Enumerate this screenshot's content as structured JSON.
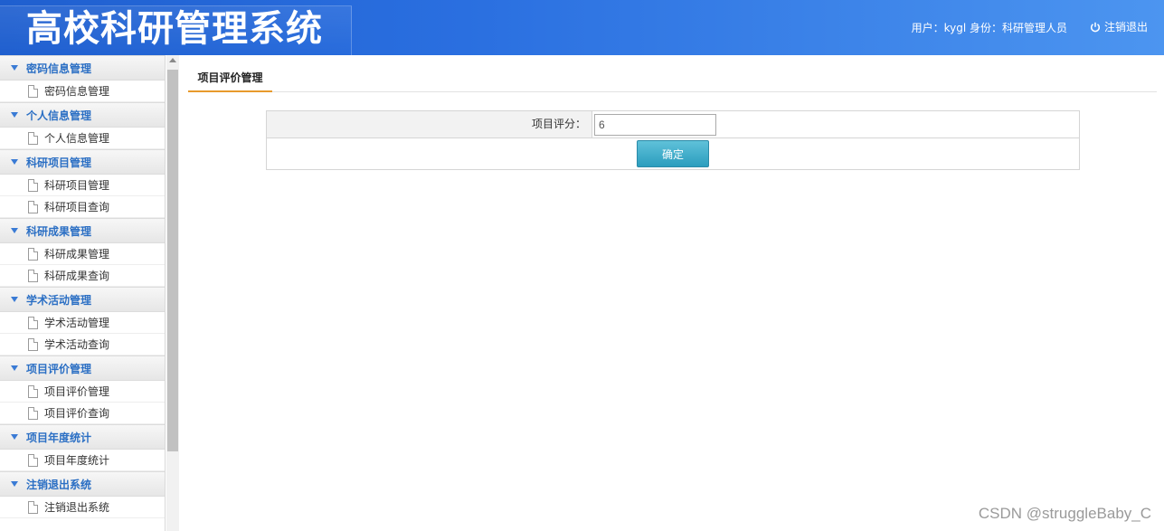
{
  "header": {
    "app_title": "高校科研管理系统",
    "user_info": "用户：kygl 身份：科研管理人员",
    "logout_label": "注销退出"
  },
  "sidebar": {
    "groups": [
      {
        "title": "密码信息管理",
        "items": [
          "密码信息管理"
        ]
      },
      {
        "title": "个人信息管理",
        "items": [
          "个人信息管理"
        ]
      },
      {
        "title": "科研项目管理",
        "items": [
          "科研项目管理",
          "科研项目查询"
        ]
      },
      {
        "title": "科研成果管理",
        "items": [
          "科研成果管理",
          "科研成果查询"
        ]
      },
      {
        "title": "学术活动管理",
        "items": [
          "学术活动管理",
          "学术活动查询"
        ]
      },
      {
        "title": "项目评价管理",
        "items": [
          "项目评价管理",
          "项目评价查询"
        ]
      },
      {
        "title": "项目年度统计",
        "items": [
          "项目年度统计"
        ]
      },
      {
        "title": "注销退出系统",
        "items": [
          "注销退出系统"
        ]
      }
    ]
  },
  "main": {
    "tab_label": "项目评价管理",
    "form": {
      "score_label": "项目评分：",
      "score_value": "6",
      "submit_label": "确定"
    }
  },
  "watermark": "CSDN @struggleBaby_C"
}
